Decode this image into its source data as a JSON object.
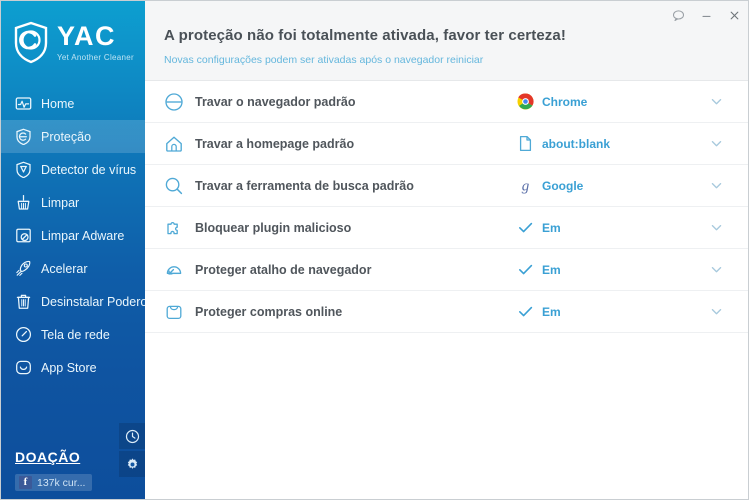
{
  "app": {
    "logo_title": "YAC",
    "logo_subtitle": "Yet Another Cleaner",
    "accent_blue": "#0f72b6",
    "value_blue": "#3aa0d4"
  },
  "sidebar": {
    "items": [
      {
        "label": "Home",
        "icon": "activity-monitor-icon",
        "active": false
      },
      {
        "label": "Proteção",
        "icon": "shield-icon",
        "active": true
      },
      {
        "label": "Detector de vírus",
        "icon": "virus-shield-icon",
        "active": false
      },
      {
        "label": "Limpar",
        "icon": "broom-icon",
        "active": false
      },
      {
        "label": "Limpar Adware",
        "icon": "adware-block-icon",
        "active": false
      },
      {
        "label": "Acelerar",
        "icon": "rocket-icon",
        "active": false
      },
      {
        "label": "Desinstalar Poderosa",
        "icon": "trash-icon",
        "active": false
      },
      {
        "label": "Tela de rede",
        "icon": "gauge-icon",
        "active": false
      },
      {
        "label": "App Store",
        "icon": "smile-bag-icon",
        "active": false
      }
    ],
    "donate_label": "DOAÇÃO",
    "facebook_label": "137k cur...",
    "tools": [
      {
        "name": "history-clock-button",
        "icon": "clock-icon"
      },
      {
        "name": "settings-button",
        "icon": "gear-icon"
      }
    ]
  },
  "header": {
    "title": "A proteção não foi totalmente ativada, favor ter certeza!",
    "subtitle": "Novas configurações podem ser ativadas após o navegador reiniciar",
    "window_buttons": [
      {
        "name": "feedback-button",
        "icon": "speech-bubble-icon"
      },
      {
        "name": "minimize-button",
        "icon": "minimize-icon"
      },
      {
        "name": "close-button",
        "icon": "close-icon"
      }
    ]
  },
  "rows": [
    {
      "icon": "browser-lock-icon",
      "label": "Travar o navegador padrão",
      "value_icon": "chrome-icon",
      "value": "Chrome",
      "chevron": "chevron-down-icon"
    },
    {
      "icon": "home-icon",
      "label": "Travar a homepage padrão",
      "value_icon": "document-icon",
      "value": "about:blank",
      "chevron": "chevron-down-icon"
    },
    {
      "icon": "search-icon",
      "label": "Travar a ferramenta de busca padrão",
      "value_icon": "google-icon",
      "value": "Google",
      "chevron": "chevron-down-icon"
    },
    {
      "icon": "puzzle-icon",
      "label": "Bloquear plugin malicioso",
      "value_icon": "check-icon",
      "value": "Em",
      "chevron": "chevron-down-icon"
    },
    {
      "icon": "shortcut-icon",
      "label": "Proteger atalho de navegador",
      "value_icon": "check-icon",
      "value": "Em",
      "chevron": "chevron-down-icon"
    },
    {
      "icon": "shopping-bag-icon",
      "label": "Proteger compras online",
      "value_icon": "check-icon",
      "value": "Em",
      "chevron": "chevron-down-icon"
    }
  ]
}
